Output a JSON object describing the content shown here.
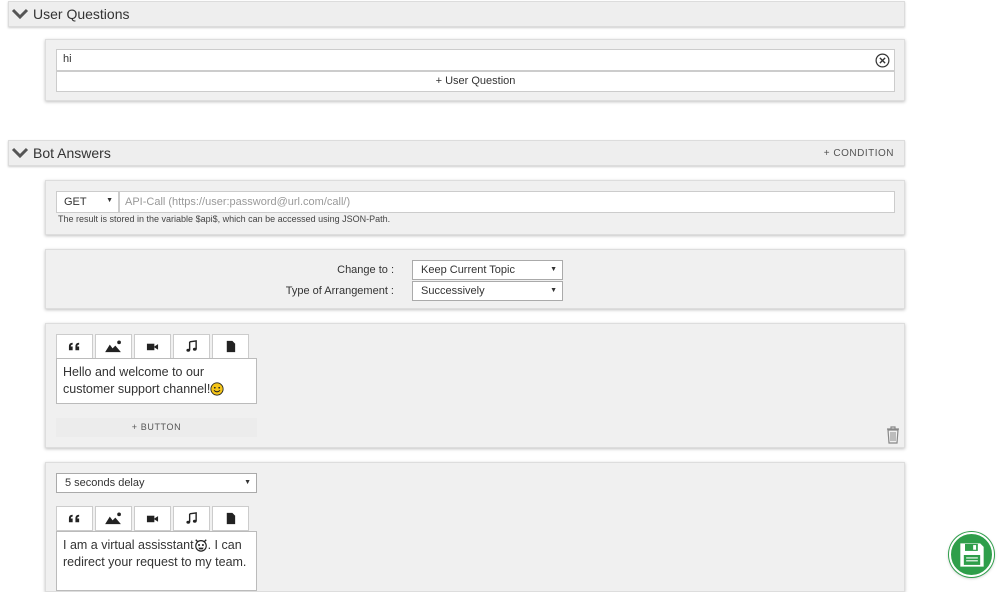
{
  "user_questions": {
    "title": "User Questions",
    "input_value": "hi",
    "add_label": "+ User Question"
  },
  "bot_answers": {
    "title": "Bot Answers",
    "condition_label": "+ CONDITION"
  },
  "api_call": {
    "method": "GET",
    "placeholder": "API-Call (https://user:password@url.com/call/)",
    "note": "The result is stored in the variable $api$, which can be accessed using JSON-Path."
  },
  "arrangement": {
    "change_to_label": "Change to :",
    "change_to_value": "Keep Current Topic",
    "type_label": "Type of Arrangement :",
    "type_value": "Successively"
  },
  "answer1": {
    "tabs": [
      "quote-icon",
      "image-icon",
      "video-icon",
      "audio-icon",
      "file-icon"
    ],
    "text": "Hello and welcome to our customer support channel!",
    "add_button_label": "+ BUTTON"
  },
  "answer2": {
    "delay_value": "5 seconds delay",
    "text_part1": "I am a virtual assisstant",
    "text_part2": ". I can redirect your request to my team."
  },
  "colors": {
    "accent_green": "#2e9e4a",
    "card_bg": "#f0f0f0",
    "header_bg": "#eeeeee"
  }
}
